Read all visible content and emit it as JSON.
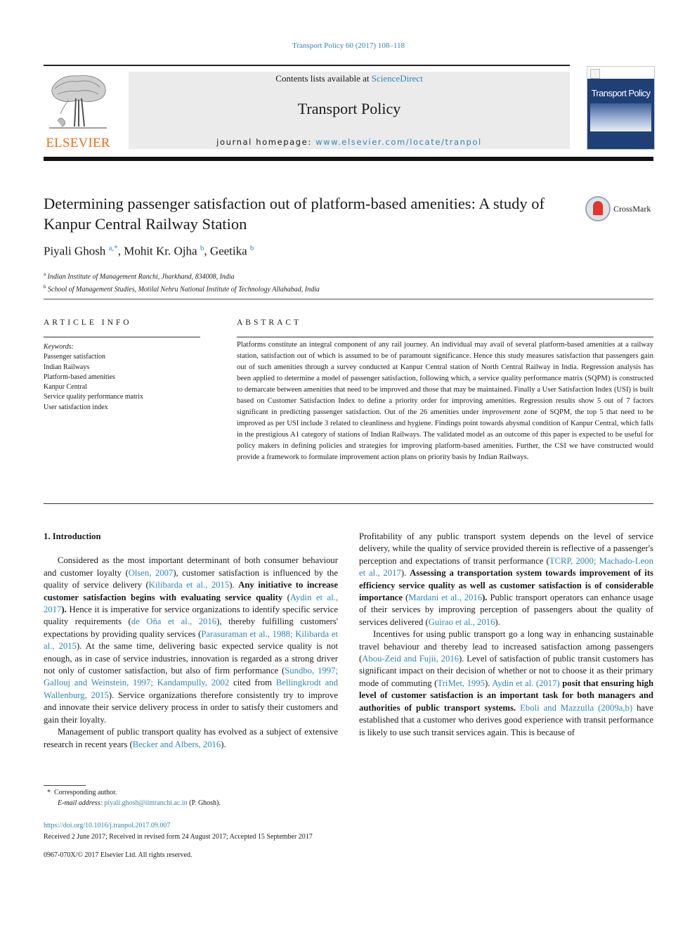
{
  "running_head": "Transport Policy 60 (2017) 108–118",
  "publisher": {
    "name": "ELSEVIER",
    "brand_color": "#e9711c"
  },
  "banner": {
    "contents_prefix": "Contents lists available at ",
    "contents_link": "ScienceDirect",
    "journal_title": "Transport Policy",
    "homepage_prefix": "journal homepage: ",
    "homepage_link": "www.elsevier.com/locate/tranpol"
  },
  "cover": {
    "title": "Transport Policy"
  },
  "crossmark": {
    "label": "CrossMark"
  },
  "article": {
    "title": "Determining passenger satisfaction out of platform-based amenities: A study of Kanpur Central Railway Station",
    "authors": [
      {
        "name": "Piyali Ghosh",
        "sup": "a,*"
      },
      {
        "name": "Mohit Kr. Ojha",
        "sup": "b"
      },
      {
        "name": "Geetika",
        "sup": "b"
      }
    ],
    "affiliations": [
      {
        "sup": "a",
        "text": "Indian Institute of Management Ranchi, Jharkhand, 834008, India"
      },
      {
        "sup": "b",
        "text": "School of Management Studies, Motilal Nehru National Institute of Technology Allahabad, India"
      }
    ]
  },
  "article_info": {
    "heading": "ARTICLE INFO",
    "keywords_label": "Keywords:",
    "keywords": [
      "Passenger satisfaction",
      "Indian Railways",
      "Platform-based amenities",
      "Kanpur Central",
      "Service quality performance matrix",
      "User satisfaction index"
    ]
  },
  "abstract": {
    "heading": "ABSTRACT",
    "part1": "Platforms constitute an integral component of any rail journey. An individual may avail of several platform-based amenities at a railway station, satisfaction out of which is assumed to be of paramount significance. Hence this study measures satisfaction that passengers gain out of such amenities through a survey conducted at Kanpur Central station of North Central Railway in India. Regression analysis has been applied to determine a model of passenger satisfaction, following which, a service quality performance matrix (SQPM) is constructed to demarcate between amenities that need to be improved and those that may be maintained. Finally a User Satisfaction Index (USI) is built based on Customer Satisfaction Index to define a priority order for improving amenities. Regression results show 5 out of 7 factors significant in predicting passenger satisfaction. Out of the 26 amenities under ",
    "italic": "improvement",
    "part2": " zone of SQPM, the top 5 that need to be improved as per USI include 3 related to cleanliness and hygiene. Findings point towards abysmal condition of Kanpur Central, which falls in the prestigious A1 category of stations of Indian Railways. The validated model as an outcome of this paper is expected to be useful for policy makers in defining policies and strategies for improving platform-based amenities. Further, the CSI we have constructed would provide a framework to formulate improvement action plans on priority basis by Indian Railways."
  },
  "intro": {
    "heading": "1.  Introduction",
    "left_p1": [
      {
        "t": "Considered as the most important determinant of both consumer behaviour and customer loyalty ("
      },
      {
        "l": "Olsen, 2007"
      },
      {
        "t": "), customer satisfaction is influenced by the quality of service delivery ("
      },
      {
        "l": "Kilibarda et al., 2015"
      },
      {
        "t": "). "
      },
      {
        "b": "Any initiative to increase customer satisfaction begins with evaluating service quality"
      },
      {
        "t": " ("
      },
      {
        "l": "Aydin et al., 2017"
      },
      {
        "b": ")."
      },
      {
        "t": " Hence it is imperative for service organizations to identify specific service quality requirements ("
      },
      {
        "l": "de Oña et al., 2016"
      },
      {
        "t": "), thereby fulfilling customers' expectations by providing quality services ("
      },
      {
        "l": "Parasuraman et al., 1988; Kilibarda et al., 2015"
      },
      {
        "t": "). At the same time, delivering basic expected service quality is not enough, as in case of service industries, innovation is regarded as a strong driver not only of customer satisfaction, but also of firm performance ("
      },
      {
        "l": "Sundbo, 1997; Gallouj and Weinstein, 1997; Kandampully, 2002"
      },
      {
        "t": " cited from "
      },
      {
        "l": "Bellingkrodt and Wallenburg, 2015"
      },
      {
        "t": "). Service organizations therefore consistently try to improve and innovate their service delivery process in order to satisfy their customers and gain their loyalty."
      }
    ],
    "left_p2": [
      {
        "t": "Management of public transport quality has evolved as a subject of extensive research in recent years ("
      },
      {
        "l": "Becker and Albers, 2016"
      },
      {
        "t": ")."
      }
    ],
    "right_p1": [
      {
        "t": "Profitability of any public transport system depends on the level of service delivery, while the quality of service provided therein is reflective of a passenger's perception and expectations of transit performance ("
      },
      {
        "l": "TCRP, 2000; Machado-Leon et al., 2017"
      },
      {
        "t": "). "
      },
      {
        "b": "Assessing a transportation system towards improvement of its efficiency service quality as well as customer satisfaction is of considerable importance"
      },
      {
        "t": " ("
      },
      {
        "l": "Mardani et al., 2016"
      },
      {
        "b": ")."
      },
      {
        "t": " Public transport operators can enhance usage of their services by improving perception of passengers about the quality of services delivered ("
      },
      {
        "l": "Guirao et al., 2016"
      },
      {
        "t": ")."
      }
    ],
    "right_p2": [
      {
        "t": "Incentives for using public transport go a long way in enhancing sustainable travel behaviour and thereby lead to increased satisfaction among passengers ("
      },
      {
        "l": "Abou-Zeid and Fujii, 2016"
      },
      {
        "t": "). Level of satisfaction of public transit customers has significant impact on their decision of whether or not to choose it as their primary mode of commuting ("
      },
      {
        "l": "TriMet, 1995"
      },
      {
        "t": "). "
      },
      {
        "l": "Aydin et al. (2017)"
      },
      {
        "t": " "
      },
      {
        "b": "posit that ensuring high level of customer satisfaction is an important task for both managers and authorities of public transport systems."
      },
      {
        "t": " "
      },
      {
        "l": "Eboli and Mazzulla (2009a,b)"
      },
      {
        "t": " have established that a customer who derives good experience with transit performance is likely to use such transit services again. This is because of"
      }
    ]
  },
  "footnotes": {
    "star": "*",
    "corresponding": "Corresponding author.",
    "email_label": "E-mail address:",
    "email": "piyali.ghosh@iimranchi.ac.in",
    "email_suffix": " (P. Ghosh)."
  },
  "doi": "https://doi.org/10.1016/j.tranpol.2017.09.007",
  "history": "Received 2 June 2017; Received in revised form 24 August 2017; Accepted 15 September 2017",
  "copyright": "0967-070X/© 2017 Elsevier Ltd. All rights reserved.",
  "colors": {
    "link": "#2e88b5",
    "banner_bg": "#ebebeb",
    "crossmark_red": "#e2362b"
  }
}
